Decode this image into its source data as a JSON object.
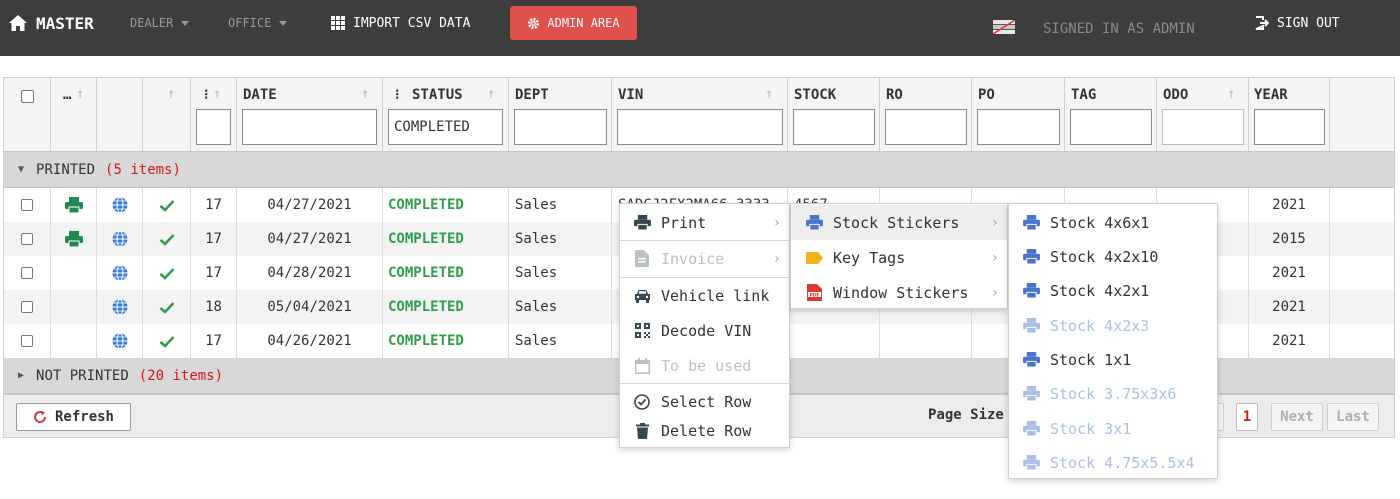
{
  "nav": {
    "brand": "MASTER",
    "dealer": "DEALER",
    "office": "OFFICE",
    "import": "IMPORT CSV DATA",
    "admin": "ADMIN AREA",
    "signed_in": "SIGNED IN AS ADMIN",
    "sign_out": "SIGN OUT"
  },
  "columns": {
    "date": "DATE",
    "status": "STATUS",
    "dept": "DEPT",
    "vin": "VIN",
    "stock": "STOCK",
    "ro": "RO",
    "po": "PO",
    "tag": "TAG",
    "odo": "ODO",
    "year": "YEAR",
    "more": "…",
    "colon": "⁝"
  },
  "filters": {
    "status": "COMPLETED"
  },
  "groups": {
    "printed": {
      "label": "PRINTED",
      "count": "(5 items)"
    },
    "not_printed": {
      "label": "NOT PRINTED",
      "count": "(20 items)"
    }
  },
  "rows": [
    {
      "num": "17",
      "date": "04/27/2021",
      "status": "COMPLETED",
      "dept": "Sales",
      "vin": "SADCJ2FX2MA66 3333",
      "stock": "4567",
      "year": "2021",
      "printed": true
    },
    {
      "num": "17",
      "date": "04/27/2021",
      "status": "COMPLETED",
      "dept": "Sales",
      "vin": "",
      "stock": "",
      "year": "2015",
      "printed": true
    },
    {
      "num": "17",
      "date": "04/28/2021",
      "status": "COMPLETED",
      "dept": "Sales",
      "vin": "",
      "stock": "",
      "year": "2021",
      "printed": false
    },
    {
      "num": "18",
      "date": "05/04/2021",
      "status": "COMPLETED",
      "dept": "Sales",
      "vin": "",
      "stock": "",
      "year": "2021",
      "printed": false
    },
    {
      "num": "17",
      "date": "04/26/2021",
      "status": "COMPLETED",
      "dept": "Sales",
      "vin": "",
      "stock": "",
      "year": "2021",
      "printed": false
    }
  ],
  "footer": {
    "refresh": "Refresh",
    "page_size": "Page Size",
    "current_page": "1",
    "next": "Next",
    "last": "Last"
  },
  "context_menu": {
    "print": "Print",
    "invoice": "Invoice",
    "vehicle_link": "Vehicle link",
    "decode_vin": "Decode VIN",
    "to_be_used": "To be used",
    "select_row": "Select Row",
    "delete_row": "Delete Row"
  },
  "print_submenu": {
    "stock_stickers": "Stock Stickers",
    "key_tags": "Key Tags",
    "window_stickers": "Window Stickers"
  },
  "sticker_submenu": [
    {
      "label": "Stock 4x6x1",
      "enabled": true
    },
    {
      "label": "Stock 4x2x10",
      "enabled": true
    },
    {
      "label": "Stock 4x2x1",
      "enabled": true
    },
    {
      "label": "Stock 4x2x3",
      "enabled": false
    },
    {
      "label": "Stock 1x1",
      "enabled": true
    },
    {
      "label": "Stock 3.75x3x6",
      "enabled": false
    },
    {
      "label": "Stock 3x1",
      "enabled": false
    },
    {
      "label": "Stock 4.75x5.5x4",
      "enabled": false
    }
  ],
  "colors": {
    "topbar": "#3d3d3d",
    "admin_button": "#e0504c",
    "status_green": "#2e9e4b",
    "count_red": "#d01a1a",
    "printer_green": "#1f8a4c",
    "globe_blue": "#3a7bd5",
    "menu_blue": "#4a74c9",
    "menu_blue_disabled": "#a9bfe6"
  }
}
